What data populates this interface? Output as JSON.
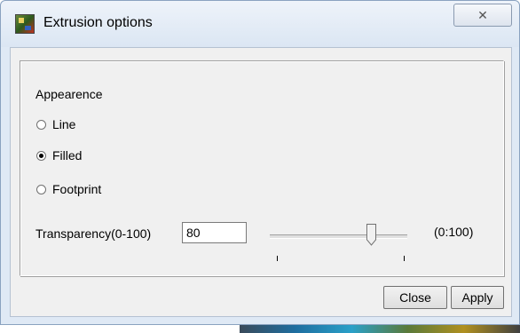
{
  "window": {
    "title": "Extrusion options",
    "close_glyph": "✕"
  },
  "group": {
    "heading": "Appearence"
  },
  "radios": [
    {
      "label": "Line",
      "checked": false
    },
    {
      "label": "Filled",
      "checked": true
    },
    {
      "label": "Footprint",
      "checked": false
    }
  ],
  "transparency": {
    "label": "Transparency(0-100)",
    "value": "80",
    "range_label": "(0:100)",
    "slider_fraction": 0.8
  },
  "buttons": {
    "close": "Close",
    "apply": "Apply"
  },
  "icons": {
    "app": "app-logo-icon",
    "close": "close-icon"
  }
}
